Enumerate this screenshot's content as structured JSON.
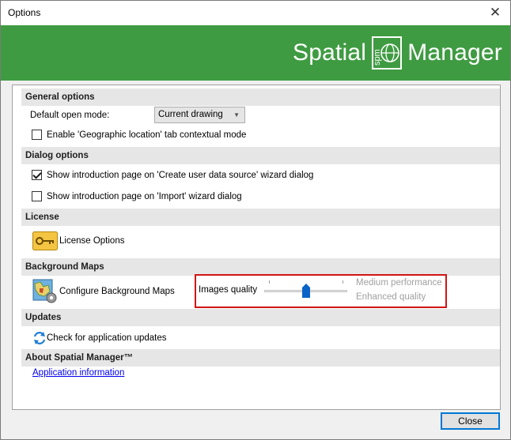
{
  "window": {
    "title": "Options",
    "close_glyph": "✕"
  },
  "banner": {
    "logo_left": "Spatial",
    "logo_mark": "spm",
    "logo_right": "Manager",
    "color": "#3f9b42"
  },
  "general": {
    "header": "General options",
    "open_mode_label": "Default open mode:",
    "open_mode_value": "Current drawing",
    "geo_tab_label": "Enable 'Geographic location' tab contextual mode",
    "geo_tab_checked": false
  },
  "dialog": {
    "header": "Dialog options",
    "intro_user_ds_label": "Show introduction page on 'Create user data source' wizard dialog",
    "intro_user_ds_checked": true,
    "intro_import_label": "Show introduction page on 'Import' wizard dialog",
    "intro_import_checked": false
  },
  "license": {
    "header": "License",
    "button_label": "License Options",
    "icon": "key-icon"
  },
  "background_maps": {
    "header": "Background Maps",
    "configure_label": "Configure Background Maps",
    "icon": "map-settings-icon",
    "images_quality_label": "Images quality",
    "medium_performance": "Medium performance",
    "enhanced_quality": "Enhanced quality",
    "slider_value": 0.5,
    "highlight_color": "#d11414"
  },
  "updates": {
    "header": "Updates",
    "check_label": "Check for application updates",
    "icon": "refresh-icon"
  },
  "about": {
    "header": "About Spatial Manager™",
    "link": "Application information"
  },
  "footer": {
    "close_label": "Close"
  }
}
